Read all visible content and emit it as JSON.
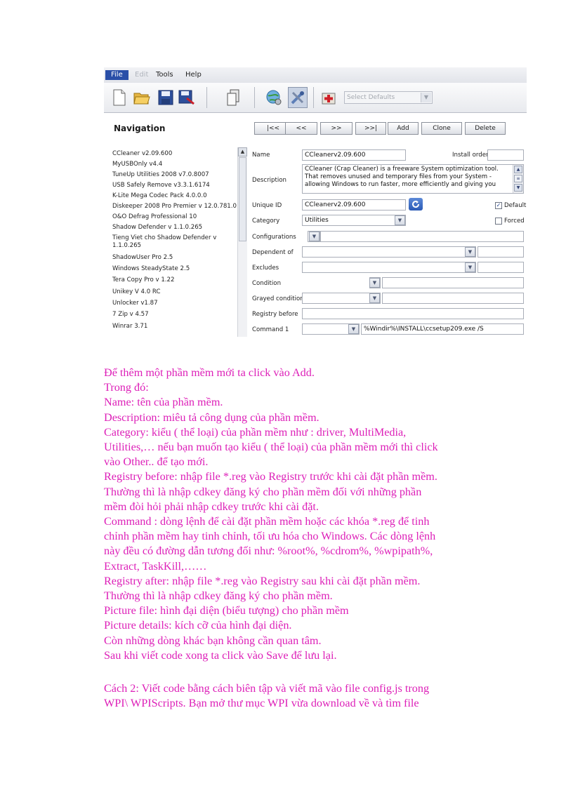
{
  "screenshot": {
    "menu": {
      "file": "File",
      "edit": "Edit",
      "tools": "Tools",
      "help": "Help"
    },
    "toolbar": {
      "defaults_value": "Select Defaults"
    },
    "navigation_title": "Navigation",
    "nav_buttons": {
      "first": "|<<",
      "prev": "<<",
      "next": ">>",
      "last": ">>|",
      "add": "Add",
      "clone": "Clone",
      "delete": "Delete"
    },
    "program_list": [
      "CCleaner v2.09.600",
      "MyUSBOnly v4.4",
      "TuneUp Utilities 2008 v7.0.8007",
      "USB Safely Remove v3.3.1.6174",
      "K-Lite Mega Codec Pack 4.0.0.0",
      "Diskeeper 2008 Pro Premier v 12.0.781.0",
      "O&O Defrag Professional 10",
      "Shadow Defender v 1.1.0.265",
      "Tieng Viet cho Shadow Defender v",
      "1.1.0.265",
      "ShadowUser Pro 2.5",
      "Windows SteadyState 2.5",
      "Tera Copy Pro v 1.22",
      "Unikey V 4.0 RC",
      "Unlocker v1.87",
      "7 Zip v 4.57",
      "Winrar 3.71"
    ],
    "form": {
      "name_label": "Name",
      "name_value": "CCleanerv2.09.600",
      "install_order_label": "Install order",
      "description_label": "Description",
      "description_value": "CCleaner (Crap Cleaner) is a freeware System optimization tool. That removes unused and temporary files from your System - allowing Windows to run faster, more efficiently and giving you",
      "unique_id_label": "Unique ID",
      "unique_id_value": "CCleanerv2.09.600",
      "default_label": "Default",
      "category_label": "Category",
      "category_value": "Utilities",
      "forced_label": "Forced",
      "configurations_label": "Configurations",
      "dependent_label": "Dependent of",
      "excludes_label": "Excludes",
      "condition_label": "Condition",
      "grayed_label": "Grayed condition",
      "registry_before_label": "Registry before",
      "command1_label": "Command 1",
      "command1_value": "%Windir%\\INSTALL\\ccsetup209.exe /S"
    }
  },
  "body_lines": [
    "Để thêm một phần mềm mới ta click vào Add.",
    "Trong đó:",
    "Name: tên của phần mềm.",
    "Description: miêu tả công dụng của phần mềm.",
    "Category: kiểu ( thể loại) của phần mềm như : driver, MultiMedia,",
    "Utilities,… nếu bạn muốn tạo kiểu ( thể loại) của phần mềm mới thì click",
    "vào Other.. để tạo mới.",
    "Registry before: nhập file *.reg vào Registry trước khi cài đặt phần mềm.",
    "Thường thì là nhập cdkey đăng ký cho phần mềm đối với những phần",
    "mềm đòi hỏi phải nhập cdkey trước khi cài đặt.",
    "Command : dòng lệnh để cài đặt phần mềm hoặc các khóa *.reg để tinh",
    "chỉnh phần mềm hay tinh chỉnh, tối ưu hóa cho Windows. Các dòng lệnh",
    "này đều có đường dẫn tương đối như: %root%, %cdrom%, %wpipath%,",
    "Extract, TaskKill,……",
    "Registry after: nhập file *.reg vào Registry sau khi cài đặt phần mềm.",
    "Thường thì là nhập cdkey đăng ký cho phần mềm.",
    "Picture file: hình đại diện (biểu tượng) cho phần mềm",
    "Picture details: kích cỡ của hình đại diện.",
    "Còn những dòng khác bạn không cần quan tâm.",
    "Sau khi viết code xong ta click vào Save để lưu lại."
  ],
  "second_lines": [
    "Cách 2: Viết code bằng cách biên tập và viết mã vào file config.js trong",
    "WPI\\ WPIScripts. Bạn mở thư mục WPI vừa download về và tìm file"
  ],
  "colors": {
    "text": "#dd1fb8",
    "menu_highlight": "#2a4fa8"
  }
}
